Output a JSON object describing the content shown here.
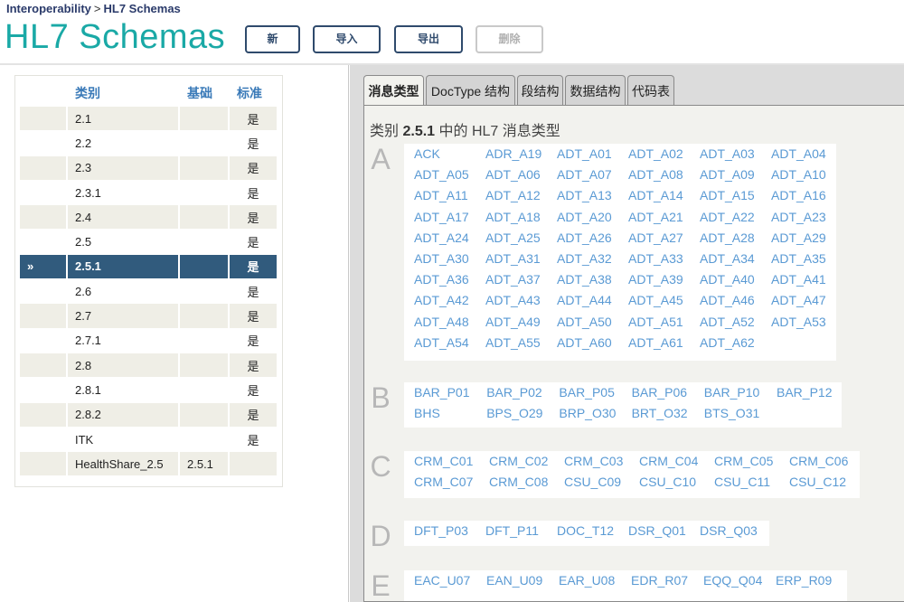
{
  "header": {
    "breadcrumb_root": "Interoperability",
    "breadcrumb_separator": ">",
    "breadcrumb_current": "HL7 Schemas",
    "title": "HL7 Schemas",
    "buttons": {
      "new": "新",
      "import": "导入",
      "export": "导出",
      "delete": "删除"
    }
  },
  "category_table": {
    "headers": {
      "category": "类别",
      "base": "基础",
      "standard": "标准"
    },
    "selected_marker": "»",
    "rows": [
      {
        "category": "2.1",
        "base": "",
        "standard": "是"
      },
      {
        "category": "2.2",
        "base": "",
        "standard": "是"
      },
      {
        "category": "2.3",
        "base": "",
        "standard": "是"
      },
      {
        "category": "2.3.1",
        "base": "",
        "standard": "是"
      },
      {
        "category": "2.4",
        "base": "",
        "standard": "是"
      },
      {
        "category": "2.5",
        "base": "",
        "standard": "是"
      },
      {
        "category": "2.5.1",
        "base": "",
        "standard": "是"
      },
      {
        "category": "2.6",
        "base": "",
        "standard": "是"
      },
      {
        "category": "2.7",
        "base": "",
        "standard": "是"
      },
      {
        "category": "2.7.1",
        "base": "",
        "standard": "是"
      },
      {
        "category": "2.8",
        "base": "",
        "standard": "是"
      },
      {
        "category": "2.8.1",
        "base": "",
        "standard": "是"
      },
      {
        "category": "2.8.2",
        "base": "",
        "standard": "是"
      },
      {
        "category": "ITK",
        "base": "",
        "standard": "是"
      },
      {
        "category": "HealthShare_2.5",
        "base": "2.5.1",
        "standard": ""
      }
    ],
    "selected_index": 6
  },
  "tabs": [
    "消息类型",
    "DocType 结构",
    "段结构",
    "数据结构",
    "代码表"
  ],
  "active_tab": 0,
  "content": {
    "title_prefix": "类别",
    "title_category": "2.5.1",
    "title_suffix": "中的 HL7 消息类型"
  },
  "groups": [
    {
      "letter": "A",
      "items": [
        "ACK",
        "ADR_A19",
        "ADT_A01",
        "ADT_A02",
        "ADT_A03",
        "ADT_A04",
        "ADT_A05",
        "ADT_A06",
        "ADT_A07",
        "ADT_A08",
        "ADT_A09",
        "ADT_A10",
        "ADT_A11",
        "ADT_A12",
        "ADT_A13",
        "ADT_A14",
        "ADT_A15",
        "ADT_A16",
        "ADT_A17",
        "ADT_A18",
        "ADT_A20",
        "ADT_A21",
        "ADT_A22",
        "ADT_A23",
        "ADT_A24",
        "ADT_A25",
        "ADT_A26",
        "ADT_A27",
        "ADT_A28",
        "ADT_A29",
        "ADT_A30",
        "ADT_A31",
        "ADT_A32",
        "ADT_A33",
        "ADT_A34",
        "ADT_A35",
        "ADT_A36",
        "ADT_A37",
        "ADT_A38",
        "ADT_A39",
        "ADT_A40",
        "ADT_A41",
        "ADT_A42",
        "ADT_A43",
        "ADT_A44",
        "ADT_A45",
        "ADT_A46",
        "ADT_A47",
        "ADT_A48",
        "ADT_A49",
        "ADT_A50",
        "ADT_A51",
        "ADT_A52",
        "ADT_A53",
        "ADT_A54",
        "ADT_A55",
        "ADT_A60",
        "ADT_A61",
        "ADT_A62"
      ]
    },
    {
      "letter": "B",
      "items": [
        "BAR_P01",
        "BAR_P02",
        "BAR_P05",
        "BAR_P06",
        "BAR_P10",
        "BAR_P12",
        "BHS",
        "BPS_O29",
        "BRP_O30",
        "BRT_O32",
        "BTS_O31"
      ]
    },
    {
      "letter": "C",
      "items": [
        "CRM_C01",
        "CRM_C02",
        "CRM_C03",
        "CRM_C04",
        "CRM_C05",
        "CRM_C06",
        "CRM_C07",
        "CRM_C08",
        "CSU_C09",
        "CSU_C10",
        "CSU_C11",
        "CSU_C12"
      ]
    },
    {
      "letter": "D",
      "items": [
        "DFT_P03",
        "DFT_P11",
        "DOC_T12",
        "DSR_Q01",
        "DSR_Q03"
      ]
    },
    {
      "letter": "E",
      "items": [
        "EAC_U07",
        "EAN_U09",
        "EAR_U08",
        "EDR_R07",
        "EQQ_Q04",
        "ERP_R09"
      ]
    }
  ]
}
